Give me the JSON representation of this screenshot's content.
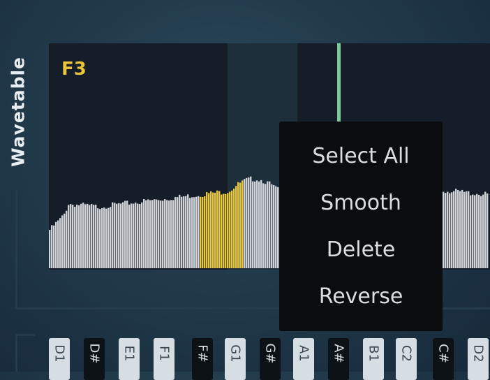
{
  "panel": {
    "label": "Wavetable",
    "note": "F3"
  },
  "colors": {
    "selected_bars": "#e8c83e",
    "bars": "#d0d4d8",
    "playhead": "#7fc99a",
    "note_label": "#e8c33c"
  },
  "waveform": {
    "selection_range": [
      0.34,
      0.44
    ]
  },
  "context_menu": {
    "items": [
      "Select All",
      "Smooth",
      "Delete",
      "Reverse"
    ]
  },
  "keyboard": {
    "keys": [
      {
        "label": "D1",
        "color": "white"
      },
      {
        "label": "D#",
        "color": "black"
      },
      {
        "label": "E1",
        "color": "white"
      },
      {
        "label": "F1",
        "color": "white"
      },
      {
        "label": "F#",
        "color": "black"
      },
      {
        "label": "G1",
        "color": "white"
      },
      {
        "label": "G#",
        "color": "black"
      },
      {
        "label": "A1",
        "color": "white"
      },
      {
        "label": "A#",
        "color": "black"
      },
      {
        "label": "B1",
        "color": "white"
      },
      {
        "label": "C2",
        "color": "white"
      },
      {
        "label": "C#",
        "color": "black"
      },
      {
        "label": "D2",
        "color": "white"
      }
    ]
  }
}
